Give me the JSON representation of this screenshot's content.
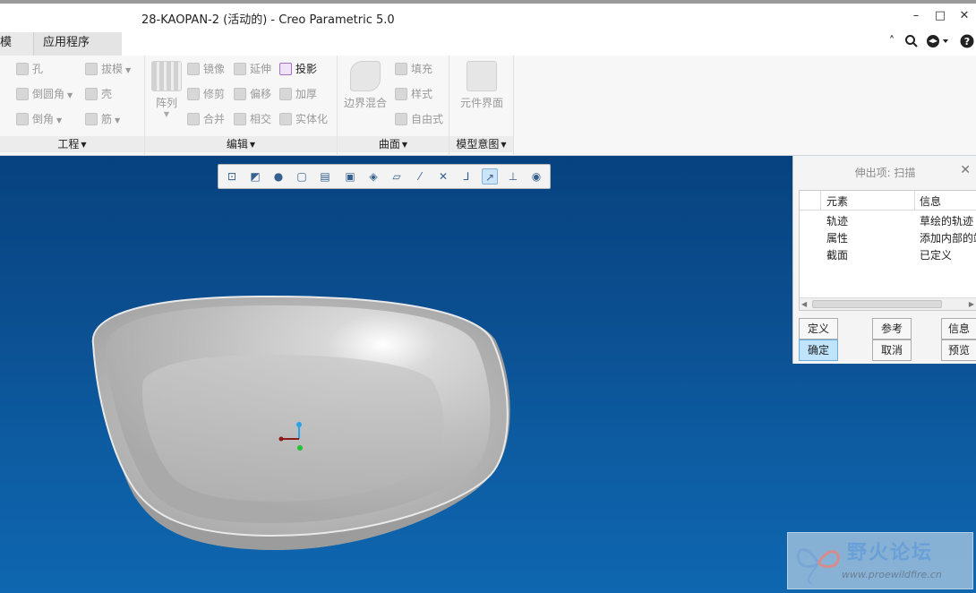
{
  "window": {
    "title": "28-KAOPAN-2 (活动的) - Creo Parametric 5.0",
    "controls": [
      "–",
      "□",
      "✕"
    ]
  },
  "tabs": [
    {
      "label": "模"
    },
    {
      "label": "应用程序"
    }
  ],
  "ribbon": {
    "groups": [
      {
        "label": "工程",
        "commands": [
          {
            "label": "孔",
            "icon": "hole-icon"
          },
          {
            "label": "拔模",
            "icon": "draft-icon"
          },
          {
            "label": "倒圆角",
            "icon": "round-icon"
          },
          {
            "label": "壳",
            "icon": "shell-icon"
          },
          {
            "label": "倒角",
            "icon": "chamfer-icon"
          },
          {
            "label": "筋",
            "icon": "rib-icon"
          }
        ]
      },
      {
        "label": "编辑",
        "array_label": "阵列",
        "commands": [
          {
            "label": "镜像",
            "icon": "mirror-icon"
          },
          {
            "label": "延伸",
            "icon": "extend-icon"
          },
          {
            "label": "投影",
            "icon": "project-icon"
          },
          {
            "label": "修剪",
            "icon": "trim-icon"
          },
          {
            "label": "偏移",
            "icon": "offset-icon"
          },
          {
            "label": "加厚",
            "icon": "thicken-icon"
          },
          {
            "label": "合并",
            "icon": "merge-icon"
          },
          {
            "label": "相交",
            "icon": "intersect-icon"
          },
          {
            "label": "实体化",
            "icon": "solidify-icon"
          }
        ]
      },
      {
        "label": "曲面",
        "big_label": "边界混合",
        "commands": [
          {
            "label": "填充",
            "icon": "fill-icon"
          },
          {
            "label": "样式",
            "icon": "style-icon"
          },
          {
            "label": "自由式",
            "icon": "freestyle-icon"
          }
        ]
      },
      {
        "label": "模型意图",
        "big_label": "元件界面"
      }
    ]
  },
  "panel": {
    "title": "伸出项: 扫描",
    "col_element": "元素",
    "col_info": "信息",
    "rows": [
      {
        "element": "轨迹",
        "info": "草绘的轨迹"
      },
      {
        "element": "属性",
        "info": "添加内部的端面"
      },
      {
        "element": "截面",
        "info": "已定义"
      }
    ],
    "buttons": {
      "define": "定义",
      "refs": "参考",
      "info": "信息",
      "ok": "确定",
      "cancel": "取消",
      "preview": "预览"
    }
  },
  "watermark": {
    "text": "野火论坛",
    "url": "www.proewildfire.cn"
  },
  "colors": {
    "viewport_top": "#07427f",
    "viewport_bottom": "#0e67b0",
    "primary_button": "#bfe3fb"
  }
}
